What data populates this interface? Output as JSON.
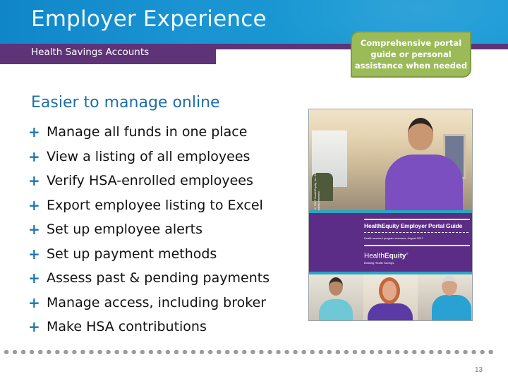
{
  "header": {
    "title": "Employer Experience",
    "subtitle": "Health Savings Accounts",
    "colors": {
      "header_blue": "#1a93d2",
      "subtitle_purple": "#5e3378"
    }
  },
  "callout": {
    "text": "Comprehensive portal\nguide or personal\nassistance when needed",
    "color": "#9bbb59"
  },
  "main": {
    "heading": "Easier to manage online",
    "bullet_icon": "plus-icon",
    "bullet_symbol": "+",
    "bullets": [
      "Manage all funds in one place",
      "View a listing of all employees",
      "Verify HSA-enrolled employees",
      "Export employee listing to Excel",
      "Set up employee alerts",
      "Set up payment methods",
      "Assess past & pending payments",
      "Manage access, including broker",
      "Make HSA contributions"
    ]
  },
  "guide_cover": {
    "title": "HealthEquity Employer Portal Guide",
    "subtitle": "Health account program resource, August 2017",
    "logo_light": "Health",
    "logo_bold": "Equity",
    "logo_mark": "®",
    "tagline": "Building Health Savings",
    "copyright": "© 2017 HealthEquity, Inc. All rights reserved."
  },
  "footer": {
    "page_number": "13"
  }
}
